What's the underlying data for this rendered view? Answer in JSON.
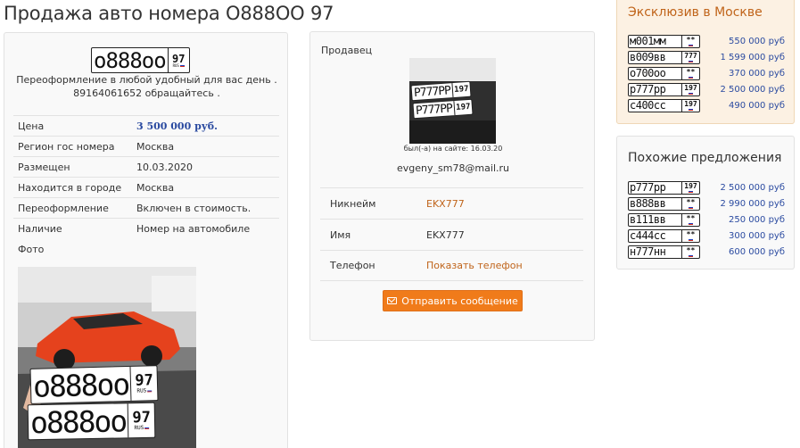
{
  "page": {
    "title": "Продажа авто номера О888ОО 97"
  },
  "listing": {
    "plate": {
      "number": "о888оо",
      "region": "97",
      "country": "RUS"
    },
    "description_line1": "Переоформление в любой удобный для вас день .",
    "description_line2": "89164061652 обращайтесь .",
    "details": [
      {
        "label": "Цена",
        "value": "3 500 000 руб."
      },
      {
        "label": "Регион гос номера",
        "value": "Москва"
      },
      {
        "label": "Размещен",
        "value": "10.03.2020"
      },
      {
        "label": "Находится в городе",
        "value": "Москва"
      },
      {
        "label": "Переоформление",
        "value": "Включен в стоимость."
      },
      {
        "label": "Наличие",
        "value": "Номер на автомобиле"
      }
    ],
    "photo_label": "Фото",
    "photo_plates": [
      {
        "number": "о888оо",
        "region": "97",
        "country": "RUS"
      },
      {
        "number": "о888оо",
        "region": "97",
        "country": "RUS"
      }
    ]
  },
  "seller": {
    "heading": "Продавец",
    "photo_plates": [
      {
        "number": "Р777РР",
        "region": "197"
      },
      {
        "number": "Р777РР",
        "region": "197"
      }
    ],
    "last_seen": "был(-а) на сайте: 16.03.20",
    "email": "evgeny_sm78@mail.ru",
    "fields": [
      {
        "label": "Никнейм",
        "value": "EKX777",
        "link": true
      },
      {
        "label": "Имя",
        "value": "EKX777",
        "link": false
      },
      {
        "label": "Телефон",
        "value": "Показать телефон",
        "link": true
      }
    ],
    "send_button": "Отправить сообщение"
  },
  "exclusive": {
    "title": "Эксклюзив в Москве",
    "items": [
      {
        "plate": "м001мм",
        "region": "**",
        "price": "550 000 руб"
      },
      {
        "plate": "в009вв",
        "region": "777",
        "price": "1 599 000 руб"
      },
      {
        "plate": "о700оо",
        "region": "**",
        "price": "370 000 руб"
      },
      {
        "plate": "р777рр",
        "region": "197",
        "price": "2 500 000 руб"
      },
      {
        "plate": "с400сс",
        "region": "197",
        "price": "490 000 руб"
      }
    ]
  },
  "similar": {
    "title": "Похожие предложения",
    "items": [
      {
        "plate": "р777рр",
        "region": "197",
        "price": "2 500 000 руб"
      },
      {
        "plate": "в888вв",
        "region": "**",
        "price": "2 990 000 руб"
      },
      {
        "plate": "в111вв",
        "region": "**",
        "price": "250 000 руб"
      },
      {
        "plate": "с444сс",
        "region": "**",
        "price": "300 000 руб"
      },
      {
        "plate": "н777нн",
        "region": "**",
        "price": "600 000 руб"
      }
    ]
  },
  "colors": {
    "accent_orange": "#f07b1a",
    "link_orange": "#c0641a",
    "price_blue": "#2a4aa0",
    "exclusive_bg": "#fcf1e3"
  }
}
